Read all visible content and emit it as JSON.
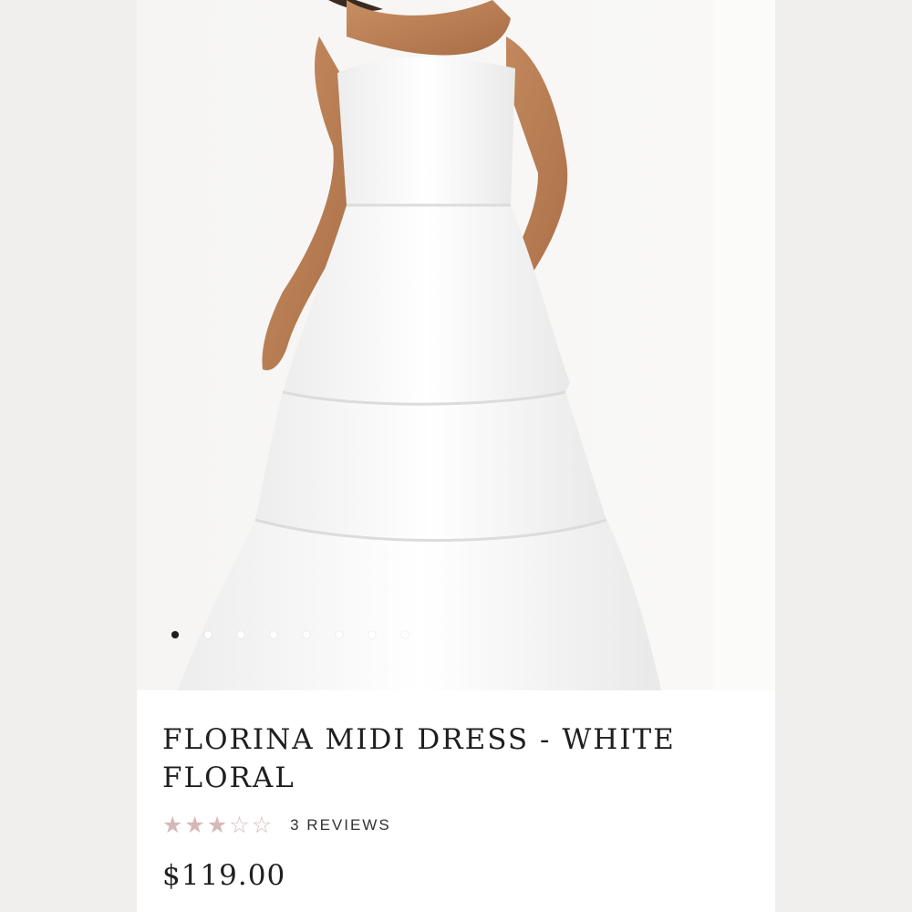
{
  "product": {
    "title": "FLORINA MIDI DRESS - WHITE FLORAL",
    "rating": 3,
    "rating_max": 5,
    "reviews_label": "3 REVIEWS",
    "price": "$119.00"
  },
  "gallery": {
    "image_count": 8,
    "active_index": 0,
    "image_description_icon": "dress-photo"
  },
  "colors": {
    "star": "#d7b8b8",
    "text": "#1f1f1f",
    "active_dot": "#1e1e1e"
  }
}
